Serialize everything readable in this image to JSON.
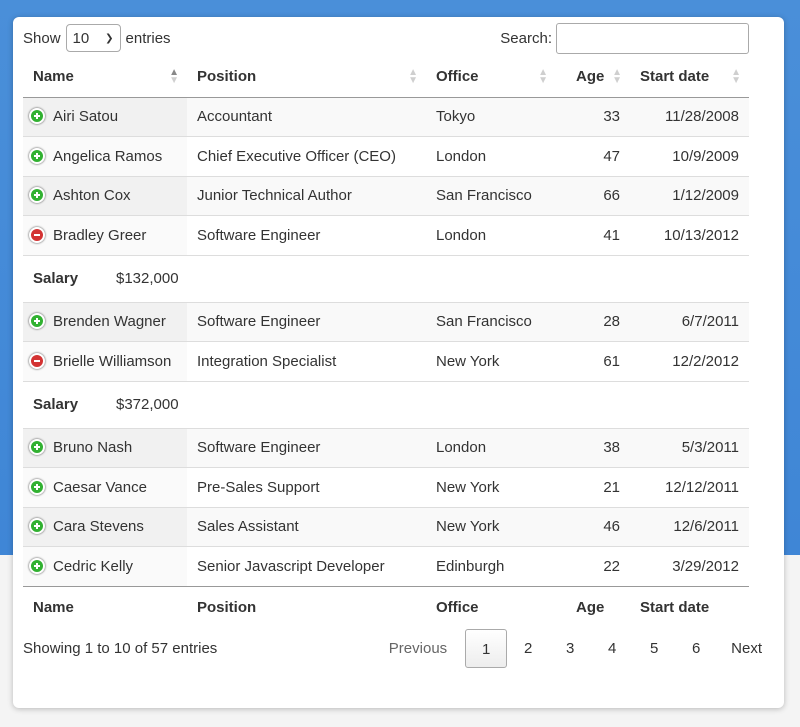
{
  "controls": {
    "show_label": "Show",
    "length_value": "10",
    "entries_label": "entries",
    "search_label": "Search:",
    "search_value": ""
  },
  "columns": [
    "Name",
    "Position",
    "Office",
    "Age",
    "Start date"
  ],
  "rows": [
    {
      "name": "Airi Satou",
      "position": "Accountant",
      "office": "Tokyo",
      "age": "33",
      "start": "11/28/2008",
      "expanded": false
    },
    {
      "name": "Angelica Ramos",
      "position": "Chief Executive Officer (CEO)",
      "office": "London",
      "age": "47",
      "start": "10/9/2009",
      "expanded": false
    },
    {
      "name": "Ashton Cox",
      "position": "Junior Technical Author",
      "office": "San Francisco",
      "age": "66",
      "start": "1/12/2009",
      "expanded": false
    },
    {
      "name": "Bradley Greer",
      "position": "Software Engineer",
      "office": "London",
      "age": "41",
      "start": "10/13/2012",
      "expanded": true,
      "child_label": "Salary",
      "child_value": "$132,000"
    },
    {
      "name": "Brenden Wagner",
      "position": "Software Engineer",
      "office": "San Francisco",
      "age": "28",
      "start": "6/7/2011",
      "expanded": false
    },
    {
      "name": "Brielle Williamson",
      "position": "Integration Specialist",
      "office": "New York",
      "age": "61",
      "start": "12/2/2012",
      "expanded": true,
      "child_label": "Salary",
      "child_value": "$372,000"
    },
    {
      "name": "Bruno Nash",
      "position": "Software Engineer",
      "office": "London",
      "age": "38",
      "start": "5/3/2011",
      "expanded": false
    },
    {
      "name": "Caesar Vance",
      "position": "Pre-Sales Support",
      "office": "New York",
      "age": "21",
      "start": "12/12/2011",
      "expanded": false
    },
    {
      "name": "Cara Stevens",
      "position": "Sales Assistant",
      "office": "New York",
      "age": "46",
      "start": "12/6/2011",
      "expanded": false
    },
    {
      "name": "Cedric Kelly",
      "position": "Senior Javascript Developer",
      "office": "Edinburgh",
      "age": "22",
      "start": "3/29/2012",
      "expanded": false
    }
  ],
  "footer": {
    "info": "Showing 1 to 10 of 57 entries",
    "previous": "Previous",
    "next": "Next",
    "pages": [
      "1",
      "2",
      "3",
      "4",
      "5",
      "6"
    ],
    "current_page": "1"
  },
  "colors": {
    "plus": "#31b131",
    "minus": "#d33333",
    "background_top": "#3f86d6"
  }
}
